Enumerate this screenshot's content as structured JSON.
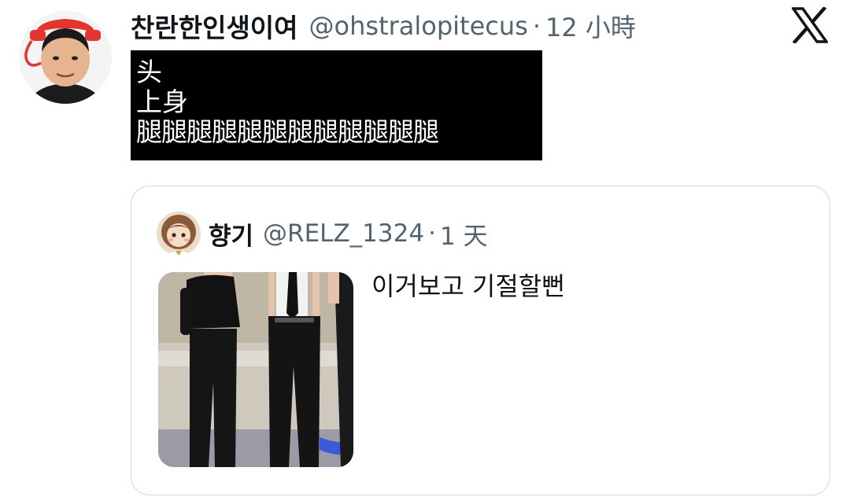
{
  "tweet": {
    "display_name": "찬란한인생이여",
    "handle": "@ohstralopitecus",
    "separator": "·",
    "time": "12 小時",
    "avatar_icon": "profile-avatar",
    "logo_icon": "x-logo-icon",
    "body_lines": [
      "头",
      "上身",
      "腿腿腿腿腿腿腿腿腿腿腿腿"
    ]
  },
  "quoted_tweet": {
    "display_name": "향기",
    "handle": "@RELZ_1324",
    "separator": "·",
    "time": "1 天",
    "avatar_icon": "profile-avatar",
    "media_icon": "photo-thumbnail",
    "text": "이거보고 기절할뻔"
  },
  "colors": {
    "text_primary": "#0f1419",
    "text_secondary": "#536471",
    "border": "#cfd9de",
    "meme_background": "#000000",
    "meme_text": "#ffffff"
  }
}
